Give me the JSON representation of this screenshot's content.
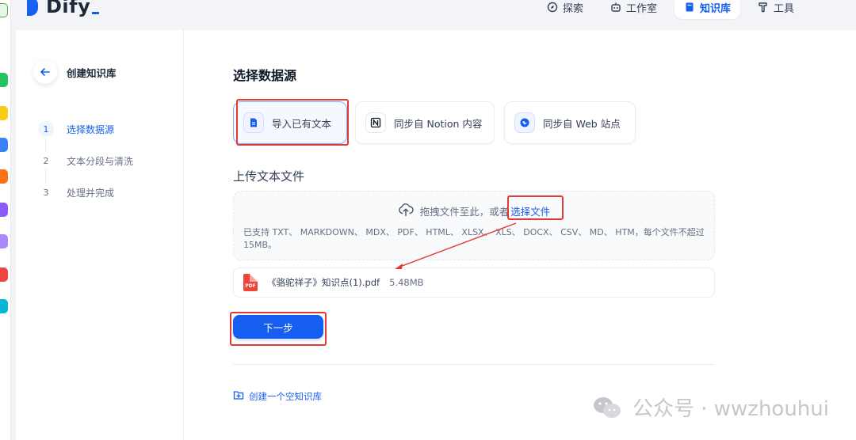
{
  "app": {
    "name": "Dify"
  },
  "nav": {
    "items": [
      {
        "label": "探索",
        "icon": "compass-icon"
      },
      {
        "label": "工作室",
        "icon": "robot-icon"
      },
      {
        "label": "知识库",
        "icon": "book-icon",
        "active": true
      },
      {
        "label": "工具",
        "icon": "hammer-icon"
      }
    ]
  },
  "sidebar": {
    "title": "创建知识库",
    "steps": [
      {
        "num": "1",
        "label": "选择数据源",
        "active": true
      },
      {
        "num": "2",
        "label": "文本分段与清洗"
      },
      {
        "num": "3",
        "label": "处理并完成"
      }
    ]
  },
  "content": {
    "section_title": "选择数据源",
    "sources": [
      {
        "label": "导入已有文本",
        "icon": "file-text-icon",
        "active": true
      },
      {
        "label": "同步自 Notion 内容",
        "icon": "notion-icon"
      },
      {
        "label": "同步自 Web 站点",
        "icon": "web-icon"
      }
    ],
    "upload_title": "上传文本文件",
    "drop_text": "拖拽文件至此，或者",
    "drop_link": "选择文件",
    "drop_help": "已支持 TXT、 MARKDOWN、 MDX、 PDF、 HTML、 XLSX、 XLS、 DOCX、 CSV、 MD、 HTM，每个文件不超过 15MB。",
    "file": {
      "name": "《骆驼祥子》知识点(1).pdf",
      "size": "5.48MB",
      "type_label": "PDF"
    },
    "next_label": "下一步",
    "empty_kb_label": "创建一个空知识库"
  },
  "watermark": {
    "text": "公众号 · wwzhouhui"
  },
  "colors": {
    "primary": "#155eef",
    "annotation": "#e53935",
    "pdf": "#f04438"
  }
}
